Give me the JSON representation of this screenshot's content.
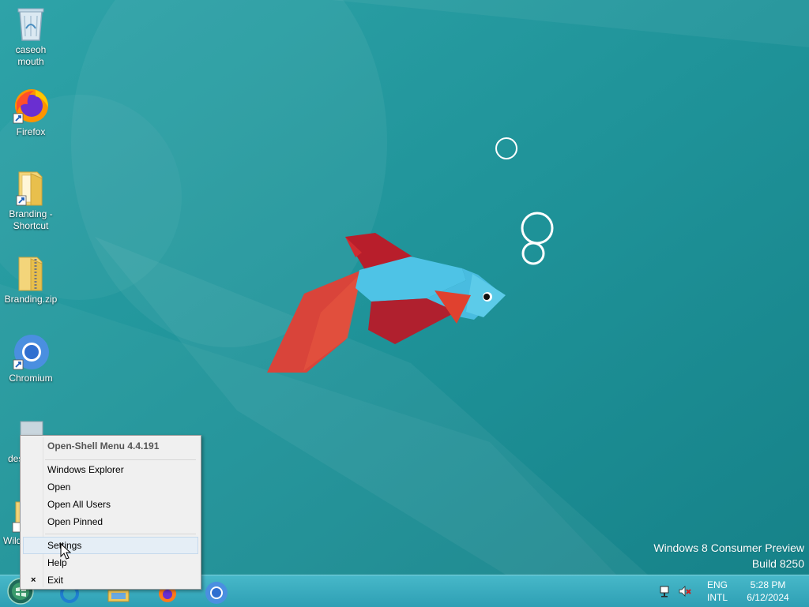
{
  "desktop": {
    "icons": [
      {
        "label_line1": "caseoh",
        "label_line2": "mouth",
        "icon": "recycle-bin-icon"
      },
      {
        "label_line1": "Firefox",
        "label_line2": "",
        "icon": "firefox-icon"
      },
      {
        "label_line1": "Branding -",
        "label_line2": "Shortcut",
        "icon": "folder-icon"
      },
      {
        "label_line1": "Branding.zip",
        "label_line2": "",
        "icon": "zip-folder-icon"
      },
      {
        "label_line1": "Chromium",
        "label_line2": "",
        "icon": "chromium-icon"
      },
      {
        "label_line1": "des",
        "label_line2": "",
        "icon": "desktop-file-icon"
      },
      {
        "label_line1": "Wild",
        "label_line2": "",
        "icon": "file-icon"
      }
    ],
    "watermark": {
      "line1": "Windows 8 Consumer Preview",
      "line2": "Build 8250"
    },
    "wallpaper_colors": {
      "teal": "#1f9299",
      "fish_blue": "#4ec3e6",
      "fish_red": "#b0202e",
      "fin_orange": "#d9443a"
    }
  },
  "context_menu": {
    "header": "Open-Shell Menu 4.4.191",
    "items": [
      {
        "label": "Windows Explorer"
      },
      {
        "label": "Open"
      },
      {
        "label": "Open All Users"
      },
      {
        "label": "Open Pinned"
      },
      {
        "label": "Settings",
        "hovered": true
      },
      {
        "label": "Help"
      },
      {
        "label": "Exit",
        "marker": "×"
      }
    ]
  },
  "taskbar": {
    "apps": [
      "start-orb-icon",
      "ie-icon",
      "explorer-icon",
      "firefox-icon",
      "chromium-icon"
    ],
    "tray": {
      "lang_top": "ENG",
      "lang_bottom": "INTL",
      "time": "5:28 PM",
      "date": "6/12/2024",
      "icons": [
        "network-icon",
        "volume-muted-icon"
      ]
    }
  },
  "colors": {
    "taskbar": "#3aaec0",
    "menu_bg": "#f0f0f0",
    "menu_hover": "#e5eef6"
  }
}
